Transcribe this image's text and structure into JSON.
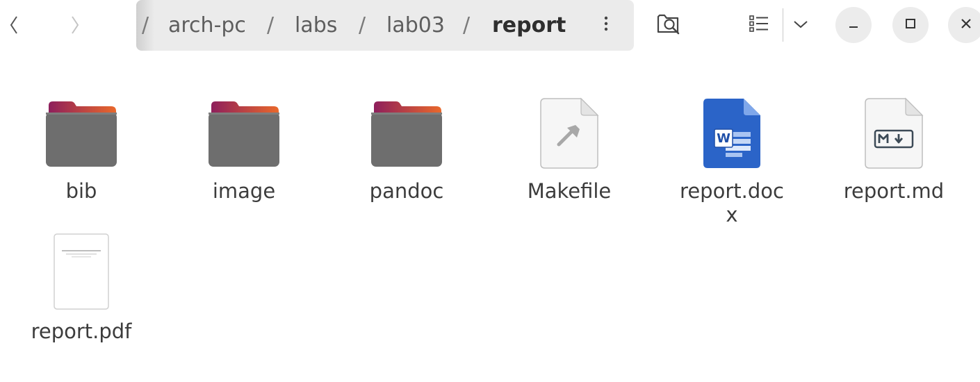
{
  "toolbar": {
    "back_icon": "chevron-left-icon",
    "forward_icon": "chevron-right-icon",
    "breadcrumb": {
      "separator": "/",
      "segments": [
        "arch-pc",
        "labs",
        "lab03",
        "report"
      ]
    },
    "menu_icon": "vertical-ellipsis-icon",
    "search_icon": "folder-search-icon",
    "view_icon": "list-view-icon",
    "view_dropdown_icon": "chevron-down-icon",
    "minimize_icon": "minimize-icon",
    "maximize_icon": "maximize-icon",
    "close_icon": "close-icon"
  },
  "files": [
    {
      "name": "bib",
      "type": "folder"
    },
    {
      "name": "image",
      "type": "folder"
    },
    {
      "name": "pandoc",
      "type": "folder"
    },
    {
      "name": "Makefile",
      "type": "makefile"
    },
    {
      "name": "report.docx",
      "type": "word-document"
    },
    {
      "name": "report.md",
      "type": "markdown"
    },
    {
      "name": "report.pdf",
      "type": "pdf"
    }
  ],
  "colors": {
    "folder_body": "#6e6e6e",
    "folder_tab_start": "#8e1f5c",
    "folder_tab_end": "#e9682b",
    "word_blue": "#2b64c8",
    "pathbar_bg": "#ebebeb"
  }
}
